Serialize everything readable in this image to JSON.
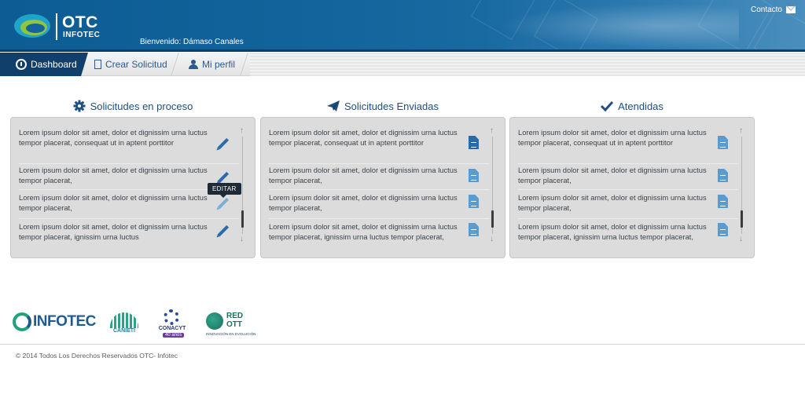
{
  "header": {
    "logo_title": "OTC",
    "logo_subtitle": "INFOTEC",
    "welcome": "Bienvenido: Dámaso Canales",
    "contact_label": "Contacto"
  },
  "nav": {
    "tabs": [
      {
        "label": "Dashboard",
        "icon": "dashboard-icon",
        "active": true
      },
      {
        "label": "Crear Solicitud",
        "icon": "document-icon",
        "active": false
      },
      {
        "label": "Mi perfil",
        "icon": "user-icon",
        "active": false
      }
    ]
  },
  "columns": [
    {
      "title": "Solicitudes en proceso",
      "icon": "gear-icon",
      "action_icon": "pencil-icon",
      "items": [
        "Lorem ipsum dolor sit amet, dolor et dignissim urna luctus tempor placerat, consequat ut in aptent porttitor",
        "Lorem ipsum dolor sit amet, dolor et dignissim urna luctus tempor placerat,",
        "Lorem ipsum dolor sit amet, dolor et dignissim urna luctus tempor placerat,",
        "Lorem ipsum dolor sit amet, dolor et dignissim urna luctus tempor placerat, ignissim urna luctus"
      ],
      "tooltip": "EDITAR"
    },
    {
      "title": "Solicitudes Enviadas",
      "icon": "paper-plane-icon",
      "action_icon": "document-icon",
      "items": [
        "Lorem ipsum dolor sit amet, dolor et dignissim urna luctus tempor placerat, consequat ut in aptent porttitor",
        "Lorem ipsum dolor sit amet, dolor et dignissim urna luctus tempor placerat,",
        "Lorem ipsum dolor sit amet, dolor et dignissim urna luctus tempor placerat,",
        "Lorem ipsum dolor sit amet, dolor et dignissim urna luctus tempor placerat, ignissim urna luctus tempor placerat,"
      ]
    },
    {
      "title": "Atendidas",
      "icon": "checkmark-icon",
      "action_icon": "document-icon",
      "items": [
        "Lorem ipsum dolor sit amet, dolor et dignissim urna luctus tempor placerat, consequat ut in aptent porttitor",
        "Lorem ipsum dolor sit amet, dolor et dignissim urna luctus tempor placerat,",
        "Lorem ipsum dolor sit amet, dolor et dignissim urna luctus tempor placerat,",
        "Lorem ipsum dolor sit amet, dolor et dignissim urna luctus tempor placerat, ignissim urna luctus tempor placerat,"
      ]
    }
  ],
  "footer": {
    "logos": {
      "infotec": "INFOTEC",
      "canieti": "CANIETI",
      "conacyt": "CONACYT",
      "conacyt_years": "40 años",
      "redott_line1": "RED",
      "redott_line2": "OTT",
      "redott_sub": "INNOVACIÓN EN EVOLUCIÓN"
    },
    "copyright": "© 2014 Todos Los Derechos Reservados OTC- Infotec"
  },
  "colors": {
    "header_blue": "#13639c",
    "active_tab": "#113f6b",
    "title_blue": "#1f4f82",
    "panel_gray": "#dcdcdc"
  }
}
